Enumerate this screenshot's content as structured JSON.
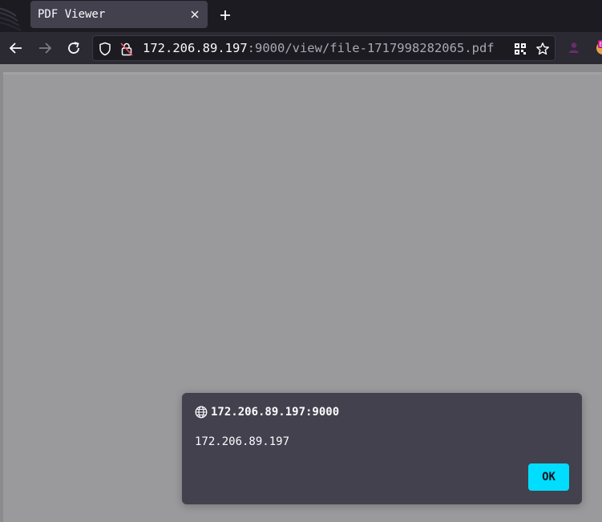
{
  "browser": {
    "tabs": [
      {
        "title": "PDF Viewer",
        "active": true
      }
    ]
  },
  "urlbar": {
    "host": "172.206.89.197",
    "rest": ":9000/view/file-1717998282065.pdf"
  },
  "icons": {
    "tab_close": "close-icon",
    "new_tab": "plus-icon",
    "back": "back-arrow-icon",
    "forward": "forward-arrow-icon",
    "reload": "reload-icon",
    "tracking": "shield-icon",
    "insecure": "insecure-lock-icon",
    "qr": "qr-code-icon",
    "bookmark": "star-icon",
    "extension1": "profile-icon",
    "extension2": "extension-badge-icon"
  },
  "dialog": {
    "origin": "172.206.89.197:9000",
    "message": "172.206.89.197",
    "ok_label": "OK"
  },
  "colors": {
    "accent": "#00ddff",
    "dialog_bg": "#42414d",
    "content_bg": "#9a9a9c"
  }
}
